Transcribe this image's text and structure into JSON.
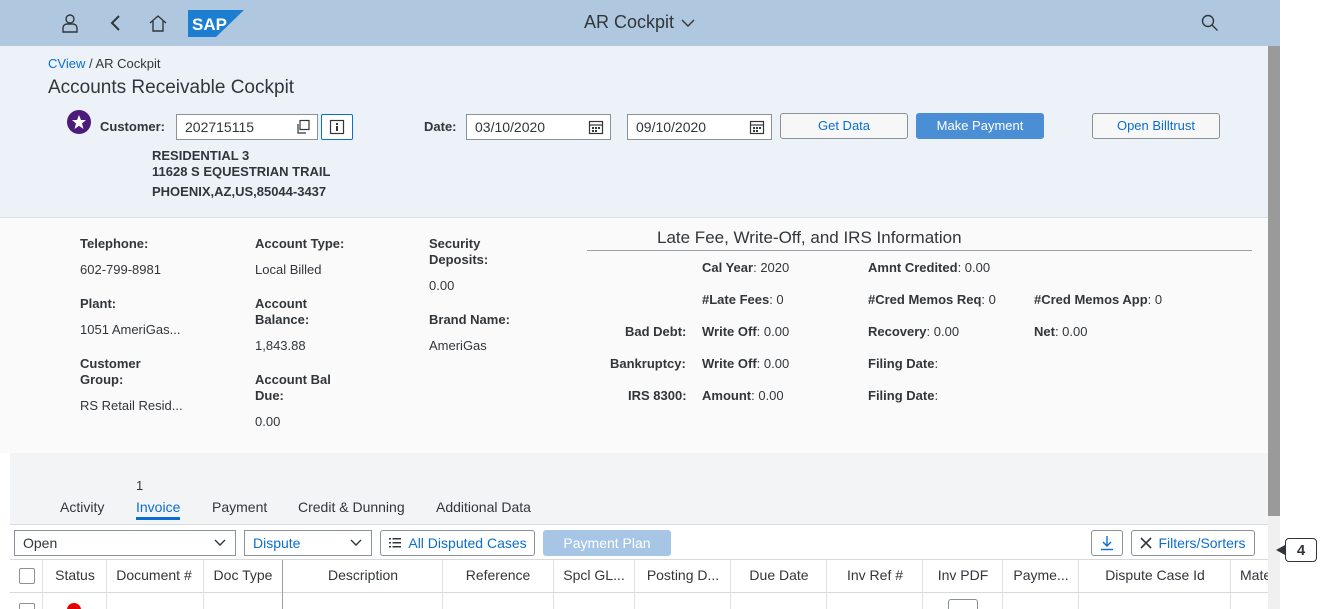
{
  "shell": {
    "title": "AR Cockpit",
    "logo_text": "SAP"
  },
  "breadcrumb": {
    "link": "CView",
    "separator": " / ",
    "current": "AR Cockpit"
  },
  "page_title": "Accounts Receivable Cockpit",
  "customer": {
    "label": "Customer:",
    "value": "202715115",
    "address_line1": "RESIDENTIAL 3",
    "address_line2": "11628 S EQUESTRIAN TRAIL",
    "address_line3": "PHOENIX,AZ,US,85044-3437"
  },
  "date": {
    "label": "Date:",
    "from": "03/10/2020",
    "to": "09/10/2020"
  },
  "buttons": {
    "get_data": "Get Data",
    "make_payment": "Make Payment",
    "open_billtrust": "Open Billtrust"
  },
  "info": {
    "telephone_label": "Telephone:",
    "telephone": "602-799-8981",
    "plant_label": "Plant:",
    "plant": "1051 AmeriGas...",
    "customer_group_label_1": "Customer",
    "customer_group_label_2": "Group:",
    "customer_group": "RS Retail Resid...",
    "account_type_label": "Account Type:",
    "account_type": "Local Billed",
    "account_balance_label_1": "Account",
    "account_balance_label_2": "Balance:",
    "account_balance": "1,843.88",
    "account_bal_due_label_1": "Account Bal",
    "account_bal_due_label_2": "Due:",
    "account_bal_due": "0.00",
    "security_deposits_label_1": "Security",
    "security_deposits_label_2": "Deposits:",
    "security_deposits": "0.00",
    "brand_name_label": "Brand Name:",
    "brand_name": "AmeriGas"
  },
  "late_fee": {
    "title": "Late Fee, Write-Off, and IRS Information",
    "cal_year_label": "Cal Year",
    "cal_year": ": 2020",
    "amnt_credited_label": "Amnt Credited",
    "amnt_credited": ": 0.00",
    "late_fees_label": "#Late Fees",
    "late_fees": ": 0",
    "cred_memos_req_label": "#Cred Memos Req",
    "cred_memos_req": ": 0",
    "cred_memos_app_label": "#Cred Memos App",
    "cred_memos_app": ": 0",
    "bad_debt_label": "Bad Debt:",
    "bad_debt_writeoff_label": "Write Off",
    "bad_debt_writeoff": ": 0.00",
    "recovery_label": "Recovery",
    "recovery": ": 0.00",
    "net_label": "Net",
    "net": ": 0.00",
    "bankruptcy_label": "Bankruptcy:",
    "bankruptcy_writeoff_label": "Write Off",
    "bankruptcy_writeoff": ": 0.00",
    "filing_date_label_1": "Filing Date",
    "filing_date_1": ":",
    "irs_label": "IRS 8300:",
    "amount_label": "Amount",
    "amount": ": 0.00",
    "filing_date_label_2": "Filing Date",
    "filing_date_2": ":"
  },
  "tabs": {
    "badge": "1",
    "activity": "Activity",
    "invoice": "Invoice",
    "payment": "Payment",
    "credit_dunning": "Credit & Dunning",
    "additional_data": "Additional Data"
  },
  "toolbar": {
    "status_select": "Open",
    "dispute_select": "Dispute",
    "all_disputed_cases": "All Disputed Cases",
    "payment_plan": "Payment Plan",
    "filters_sorters": "Filters/Sorters"
  },
  "table": {
    "columns": [
      "Status",
      "Document #",
      "Doc Type",
      "Description",
      "Reference",
      "Spcl GL...",
      "Posting D...",
      "Due Date",
      "Inv Ref #",
      "Inv PDF",
      "Payme...",
      "Dispute Case Id",
      "Mate"
    ]
  },
  "callout": "4",
  "colors": {
    "shellbar": "#afc8df",
    "header": "#ecf2f7",
    "accent": "#0a6ed1",
    "primary_button": "#4a8fd6",
    "star": "#4b1c7a"
  }
}
